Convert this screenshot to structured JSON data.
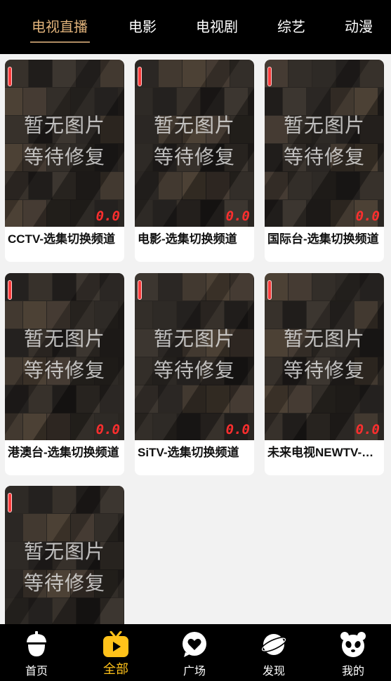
{
  "tabs": [
    {
      "label": "电视直播",
      "active": true
    },
    {
      "label": "电影",
      "active": false
    },
    {
      "label": "电视剧",
      "active": false
    },
    {
      "label": "综艺",
      "active": false
    },
    {
      "label": "动漫",
      "active": false
    }
  ],
  "placeholder": {
    "line1": "暂无图片",
    "line2": "等待修复"
  },
  "cards": [
    {
      "title": "CCTV-选集切换频道",
      "score": "0.0"
    },
    {
      "title": "电影-选集切换频道",
      "score": "0.0"
    },
    {
      "title": "国际台-选集切换频道",
      "score": "0.0"
    },
    {
      "title": "港澳台-选集切换频道",
      "score": "0.0"
    },
    {
      "title": "SiTV-选集切换频道",
      "score": "0.0"
    },
    {
      "title": "未来电视NEWTV-选集切换频道",
      "score": "0.0"
    },
    {
      "title": "",
      "score": ""
    }
  ],
  "bottom_nav": [
    {
      "label": "首页",
      "icon": "acorn-icon",
      "active": false
    },
    {
      "label": "全部",
      "icon": "play-tv-icon",
      "active": true
    },
    {
      "label": "广场",
      "icon": "heart-bubble-icon",
      "active": false
    },
    {
      "label": "发现",
      "icon": "planet-icon",
      "active": false
    },
    {
      "label": "我的",
      "icon": "panda-icon",
      "active": false
    }
  ],
  "colors": {
    "active_tab": "#e0b27a",
    "active_nav": "#ffc21a",
    "score": "#ff2e2e",
    "flag": "#ff3b3b"
  }
}
